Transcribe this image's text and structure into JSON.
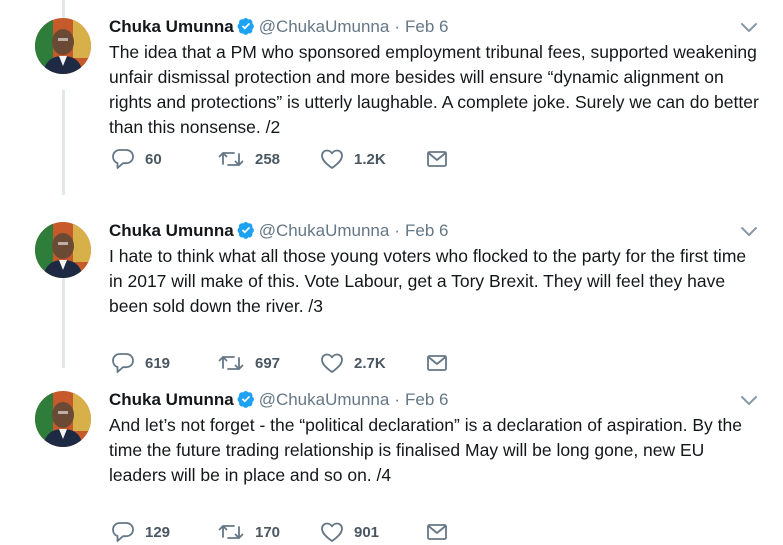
{
  "author": {
    "name": "Chuka Umunna",
    "handle": "@ChukaUmunna",
    "verified": true
  },
  "colors": {
    "verified_badge": "#1da1f2",
    "secondary_text": "#657786",
    "thread_line": "#e1e8ed"
  },
  "tweets": [
    {
      "date": "Feb 6",
      "text": "The idea that a PM who sponsored employment tribunal fees, supported weakening unfair dismissal protection and more besides will ensure “dynamic alignment on rights and protections” is utterly laughable. A complete joke. Surely we can do better than this nonsense. /2",
      "replies": "60",
      "retweets": "258",
      "likes": "1.2K"
    },
    {
      "date": "Feb 6",
      "text": "I hate to think what all those young voters who flocked to the party for the first time in 2017 will make of this. Vote Labour, get a Tory Brexit. They will feel they have been sold down the river. /3",
      "replies": "619",
      "retweets": "697",
      "likes": "2.7K"
    },
    {
      "date": "Feb 6",
      "text": "And let’s not forget - the “political declaration” is a declaration of aspiration. By the time the future trading relationship is finalised May will be long gone, new EU leaders will be in place and so on. /4",
      "replies": "129",
      "retweets": "170",
      "likes": "901"
    }
  ],
  "icons": {
    "reply": "reply-icon",
    "retweet": "retweet-icon",
    "like": "heart-icon",
    "dm": "envelope-icon",
    "caret": "chevron-down-icon",
    "verified": "verified-badge-icon"
  }
}
